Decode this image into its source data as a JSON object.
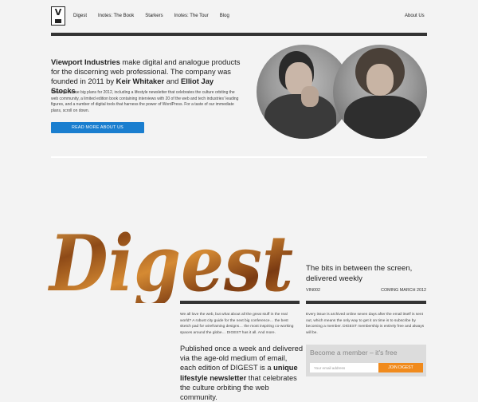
{
  "header": {
    "logo_letter": "V",
    "nav": [
      "Digest",
      "Inotes: The Book",
      "Starkers",
      "Inotes: The Tour",
      "Blog"
    ],
    "about": "About Us"
  },
  "intro": {
    "lead_prefix": "Viewport Industries",
    "lead_mid": " make digital and analogue products for the discerning web professional. The company was founded in 2011 by ",
    "founder1": "Keir Whitaker",
    "lead_and": " and ",
    "founder2": "Elliot Jay Stocks",
    "lead_end": ".",
    "body": "We've got some big plans for 2012, including a lifestyle newsletter that celebrates the culture orbiting the web community, a limited edition book containing interviews with 20 of the web and tech industries' leading figures, and a number of digital tools that harness the power of WordPress. For a taste of our immediate plans, scroll on down.",
    "button": "READ MORE ABOUT US"
  },
  "digest": {
    "title": "Digest",
    "tagline": "The bits in between the screen, delivered weekly",
    "issue": "VIN002",
    "coming": "COMING MARCH 2012",
    "col1": "We all love the web, but what about all the great stuff in the real world? A robust city guide for the next big conference… the best sketch pad for wireframing designs… the most inspiring co-working spaces around the globe… DIGEST has it all. And more.",
    "col2": "Every issue is archived online seven days after the email itself is sent out, which means the only way to get it on time is to subscribe by becoming a member. DIGEST membership is entirely free and always will be.",
    "para_a": "Published once a week and delivered via the age-old medium of email, each edition of DIGEST is a ",
    "para_bold": "unique lifestyle newsletter",
    "para_b": " that celebrates the culture orbiting the web community.",
    "member_head": "Become a member – it's free",
    "email_placeholder": "Your email address",
    "join": "JOIN DIGEST"
  },
  "colors": {
    "accent_blue": "#1a7ecf",
    "accent_orange": "#f08a1c",
    "rule": "#333333"
  }
}
